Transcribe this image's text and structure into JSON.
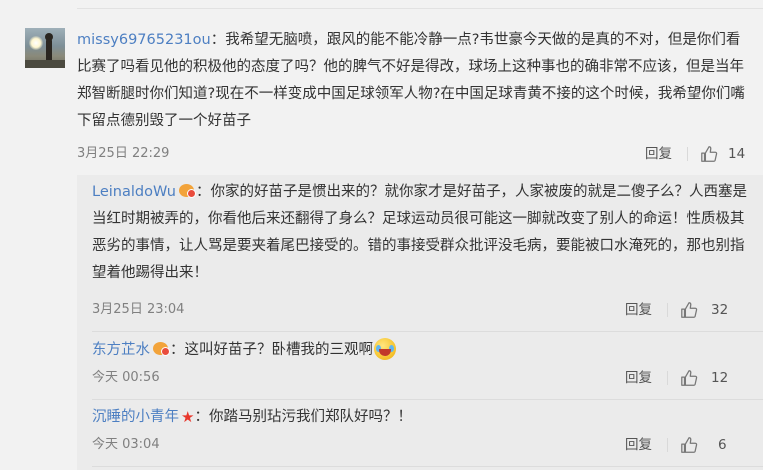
{
  "main_comment": {
    "username": "missy69765231ou",
    "text": "：我希望无脑喷，跟风的能不能冷静一点?韦世豪今天做的是真的不对，但是你们看比赛了吗看见他的积极他的态度了吗？他的脾气不好是得改，球场上这种事也的确非常不应该，但是当年郑智断腿时你们知道?现在不一样变成中国足球领军人物?在中国足球青黄不接的这个时候，我希望你们嘴下留点德别毁了一个好苗子",
    "time": "3月25日 22:29",
    "reply_label": "回复",
    "like_count": "14"
  },
  "replies": [
    {
      "username": "LeinaldoWu",
      "badge": "vip-badge-icon",
      "text": "：你家的好苗子是惯出来的？就你家才是好苗子，人家被废的就是二傻子么？人西塞是当红时期被弄的，你看他后来还翻得了身么？足球运动员很可能这一脚就改变了别人的命运！性质极其恶劣的事情，让人骂是要夹着尾巴接受的。错的事接受群众批评没毛病，要能被口水淹死的，那也别指望着他踢得出来！",
      "time": "3月25日 23:04",
      "reply_label": "回复",
      "like_count": "32"
    },
    {
      "username": "东方芷水",
      "badge": "vip-badge-icon",
      "text": "：这叫好苗子？卧槽我的三观啊",
      "emoji": "laughing-crying-emoji-icon",
      "time": "今天 00:56",
      "reply_label": "回复",
      "like_count": "12"
    },
    {
      "username": "沉睡的小青年",
      "badge": "red-star-badge-icon",
      "text": "：你踏马别玷污我们郑队好吗？！",
      "time": "今天 03:04",
      "reply_label": "回复",
      "like_count": "6"
    }
  ],
  "colors": {
    "link": "#4d7fc2",
    "background": "#f2f2f2",
    "reply_background": "#ebebeb",
    "meta": "#808080"
  }
}
